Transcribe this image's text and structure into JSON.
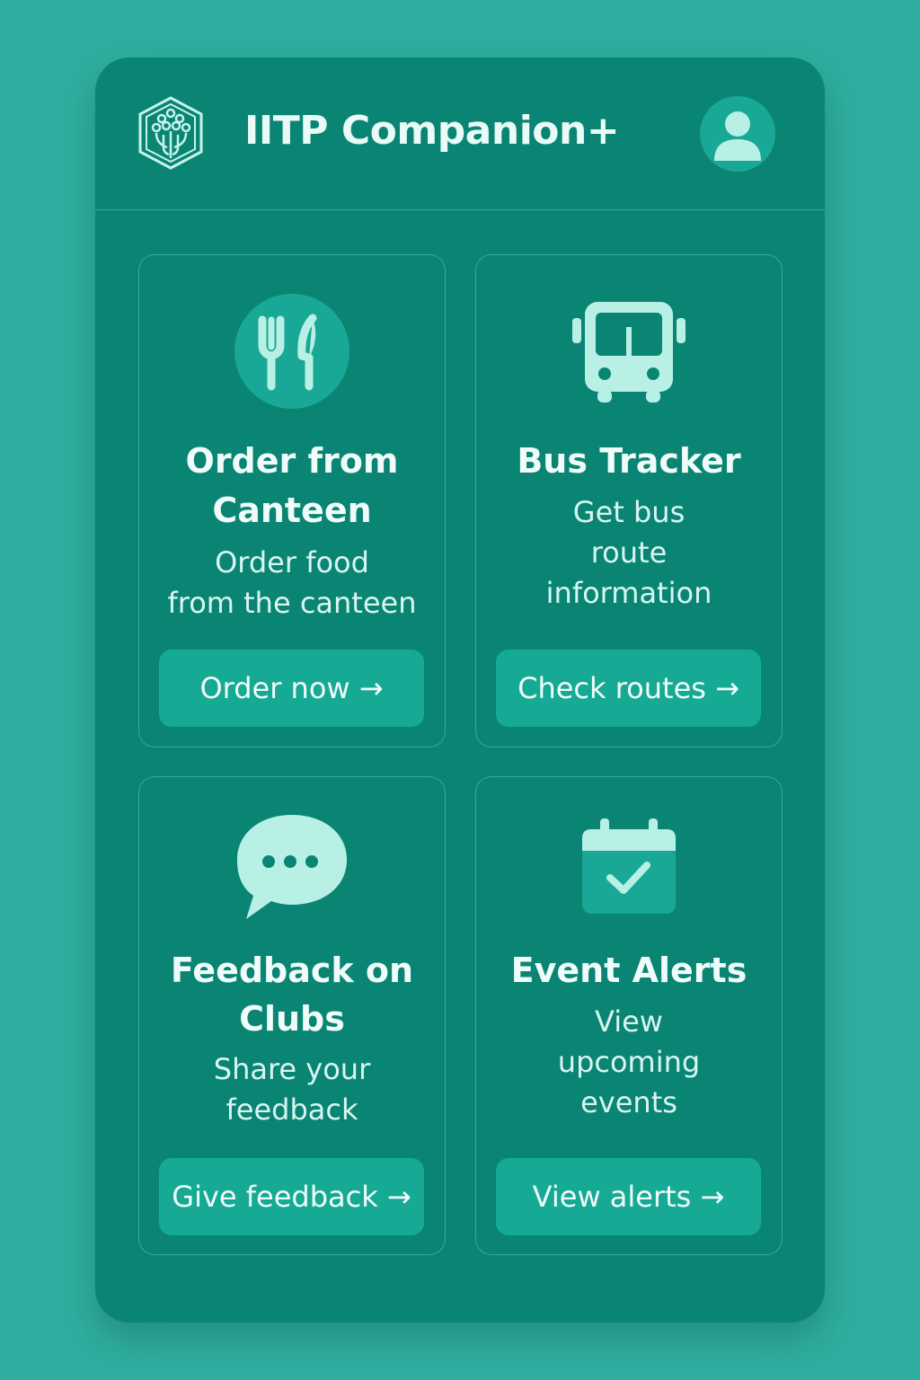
{
  "header": {
    "title": "IITP Companion+"
  },
  "cards": [
    {
      "title_line1": "Order from",
      "title_line2": "Canteen",
      "desc_line1": "Order food",
      "desc_line2": "from the canteen",
      "button": "Order now →",
      "icon": "fork-knife-icon"
    },
    {
      "title_line1": "Bus Tracker",
      "desc_line1": "Get bus",
      "desc_line2": "route",
      "desc_line3": "information",
      "button": "Check routes →",
      "icon": "bus-icon"
    },
    {
      "title_line1": "Feedback on",
      "title_line2": "Clubs",
      "desc_line1": "Share your",
      "desc_line2": "feedback",
      "button": "Give feedback →",
      "icon": "chat-bubble-icon"
    },
    {
      "title_line1": "Event Alerts",
      "desc_line1": "View",
      "desc_line2": "upcoming",
      "desc_line3": "events",
      "button": "View alerts →",
      "icon": "calendar-check-icon"
    }
  ],
  "colors": {
    "page_background": "#2fae9f",
    "panel_background": "#0a8574",
    "button_background": "#16aa95",
    "icon_light": "#b8f0e6"
  }
}
